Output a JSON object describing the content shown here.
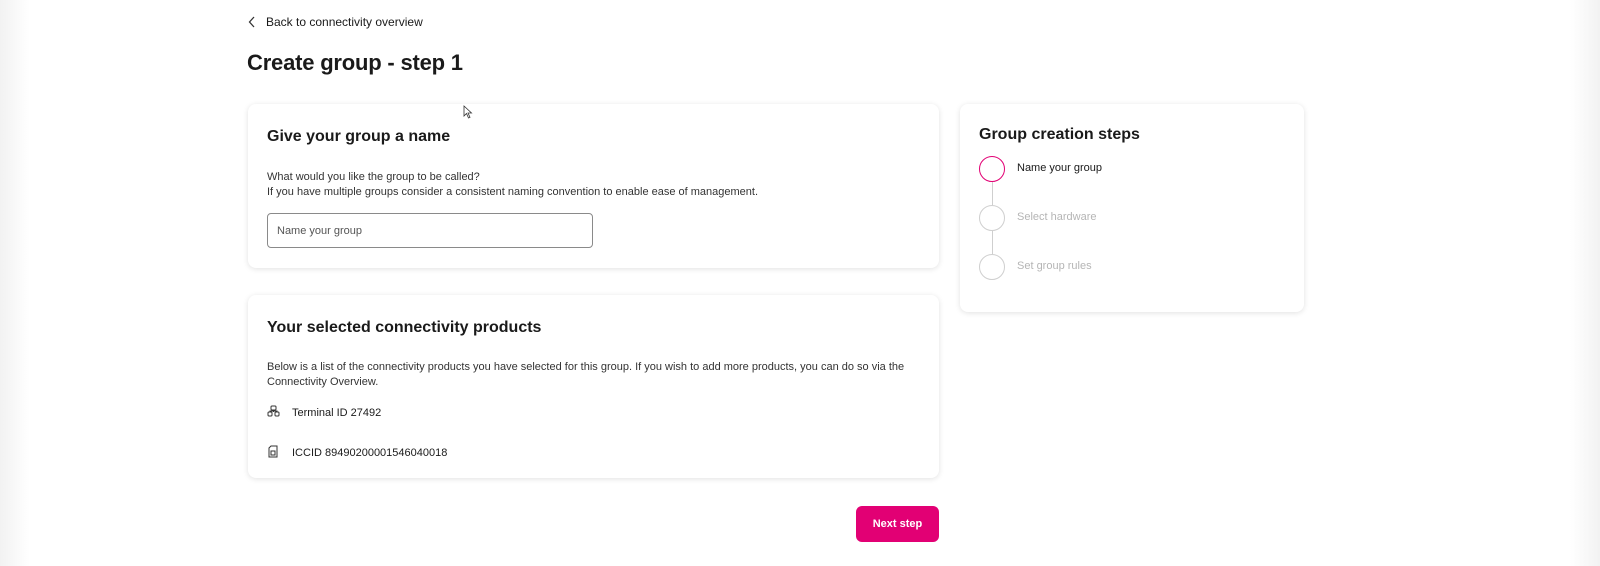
{
  "nav": {
    "back_label": "Back to connectivity overview"
  },
  "page": {
    "title": "Create group - step 1"
  },
  "name_card": {
    "title": "Give your group a name",
    "description_line1": "What would you like the group to be called?",
    "description_line2": "If you have multiple groups consider a consistent naming convention to enable ease of management.",
    "input_placeholder": "Name your group",
    "input_value": ""
  },
  "products_card": {
    "title": "Your selected connectivity products",
    "description": "Below is a list of the connectivity products you have selected for this group. If you wish to add more products, you can do so via the Connectivity Overview.",
    "items": [
      {
        "icon": "terminal-icon",
        "label": "Terminal ID 27492"
      },
      {
        "icon": "sim-card-icon",
        "label": "ICCID 89490200001546040018"
      }
    ]
  },
  "steps_card": {
    "title": "Group creation steps",
    "steps": [
      {
        "label": "Name your group",
        "state": "active"
      },
      {
        "label": "Select hardware",
        "state": "upcoming"
      },
      {
        "label": "Set group rules",
        "state": "upcoming"
      }
    ]
  },
  "actions": {
    "next_label": "Next step"
  },
  "colors": {
    "accent": "#e20074",
    "text": "#1a1a1a",
    "muted": "#b5b5b5"
  }
}
